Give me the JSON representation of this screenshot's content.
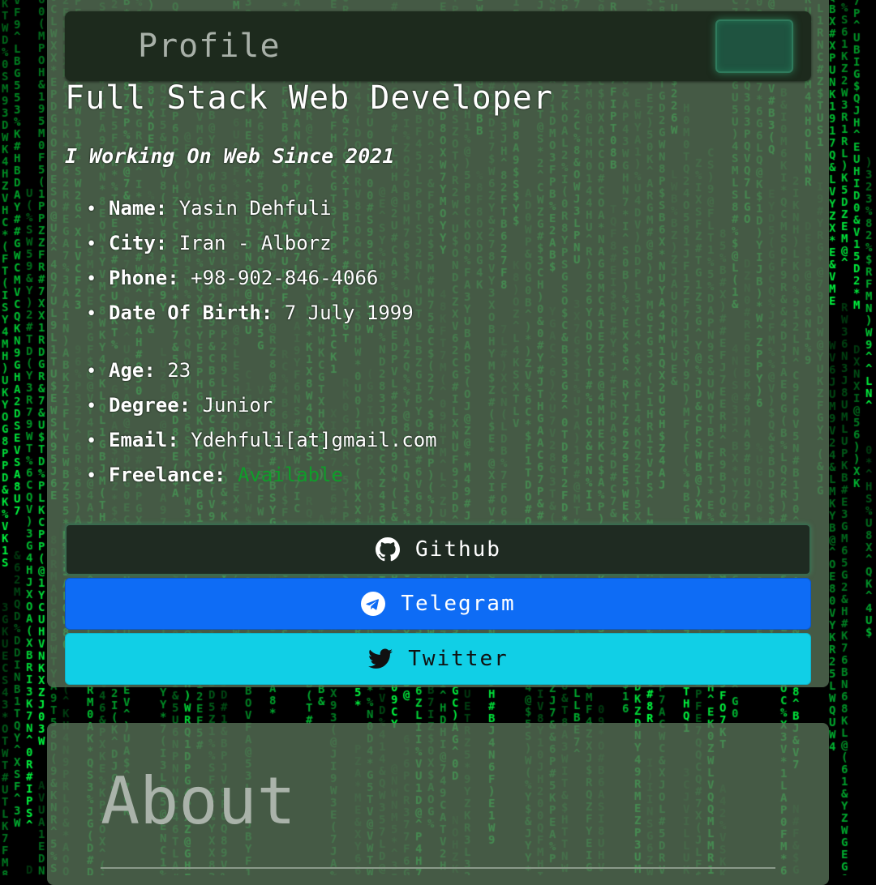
{
  "profile": {
    "header_title": "Profile",
    "job_title": "Full Stack Web Developer",
    "tagline": "I Working On Web Since 2021",
    "info_primary": [
      {
        "label": "Name:",
        "value": "Yasin Dehfuli"
      },
      {
        "label": "City:",
        "value": "Iran - Alborz"
      },
      {
        "label": "Phone:",
        "value": "+98-902-846-4066"
      },
      {
        "label": "Date Of Birth:",
        "value": "7 July 1999"
      }
    ],
    "info_secondary": [
      {
        "label": "Age:",
        "value": "23"
      },
      {
        "label": "Degree:",
        "value": "Junior"
      },
      {
        "label": "Email:",
        "value": "Ydehfuli[at]gmail.com"
      },
      {
        "label": "Freelance:",
        "value": "Available"
      }
    ],
    "social": {
      "github_label": "Github",
      "telegram_label": "Telegram",
      "twitter_label": "Twitter"
    }
  },
  "about": {
    "title": "About"
  },
  "icons": {
    "github": "github-icon",
    "telegram": "telegram-icon",
    "twitter": "twitter-icon"
  },
  "colors": {
    "matrix_green": "#00ff41",
    "panel": "#567056",
    "telegram": "#0e6cf5",
    "twitter": "#11cfe6",
    "available": "#0f9d2a"
  }
}
